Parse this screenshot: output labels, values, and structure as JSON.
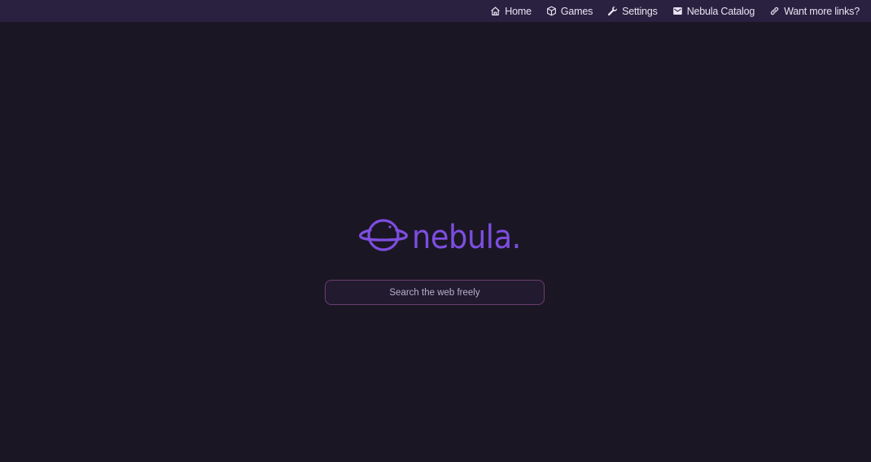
{
  "nav": {
    "items": [
      {
        "label": "Home",
        "icon": "home-icon"
      },
      {
        "label": "Games",
        "icon": "cube-icon"
      },
      {
        "label": "Settings",
        "icon": "wrench-icon"
      },
      {
        "label": "Nebula Catalog",
        "icon": "envelope-icon"
      },
      {
        "label": "Want more links?",
        "icon": "link-icon"
      }
    ]
  },
  "logo": {
    "wordmark": "nebula.",
    "icon": "planet-icon",
    "color": "#7d4ee0"
  },
  "search": {
    "placeholder": "Search the web freely",
    "value": ""
  },
  "colors": {
    "background": "#1b1624",
    "topbar": "#2a2140",
    "accent": "#7d4ee0",
    "search_border": "#6a3d70"
  }
}
